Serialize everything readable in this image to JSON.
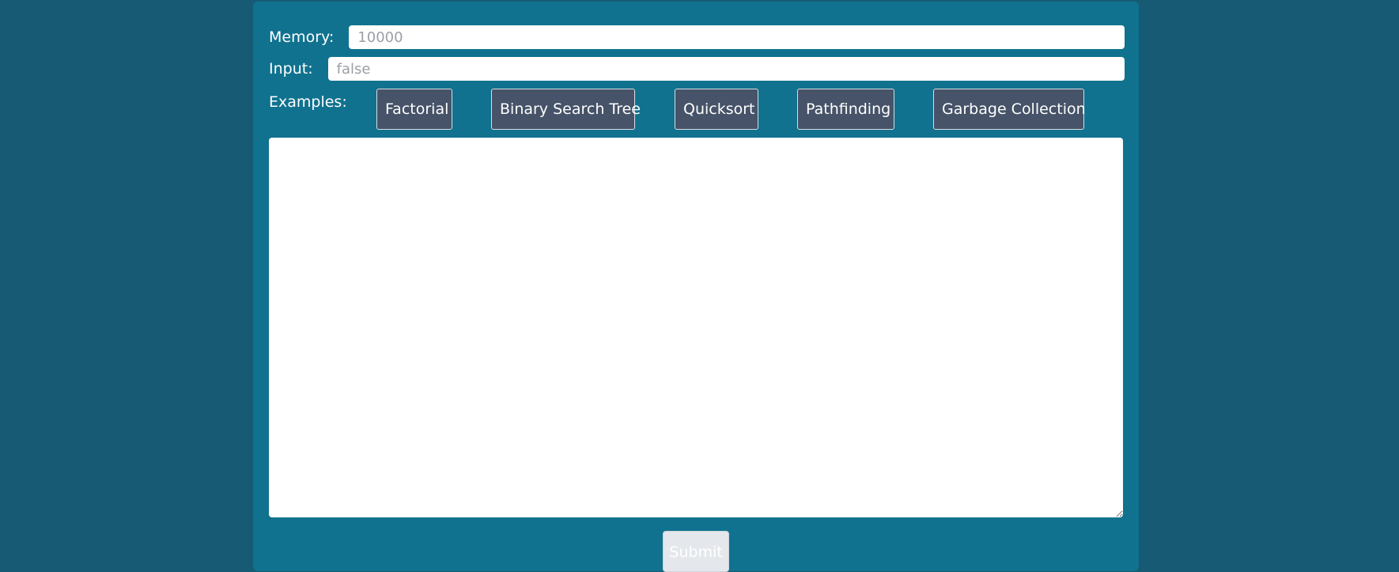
{
  "form": {
    "memory_label": "Memory:",
    "memory_placeholder": "10000",
    "memory_value": "",
    "input_label": "Input:",
    "input_placeholder": "false",
    "input_value": "",
    "examples_label": "Examples:",
    "examples": [
      {
        "label": "Factorial"
      },
      {
        "label": "Binary Search Tree"
      },
      {
        "label": "Quicksort"
      },
      {
        "label": "Pathfinding"
      },
      {
        "label": "Garbage Collection"
      }
    ],
    "code_value": "",
    "submit_label": "Submit"
  },
  "colors": {
    "page_background": "#165a73",
    "panel_background": "#10728f",
    "example_button_background": "#465368",
    "submit_button_background": "#e4e7ec"
  }
}
